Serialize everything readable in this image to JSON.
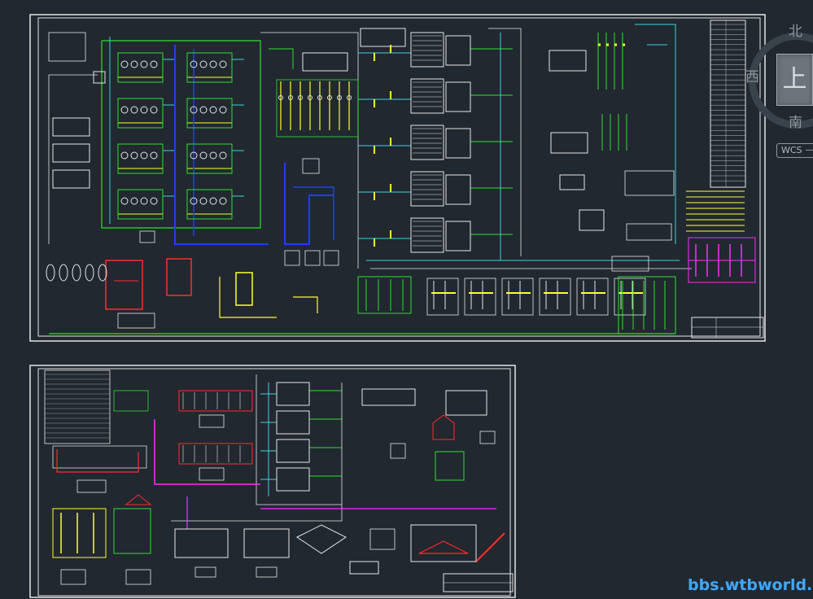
{
  "viewcube": {
    "north": "北",
    "west": "西",
    "south": "南",
    "face": "上",
    "wcs_label": "WCS"
  },
  "watermark": "bbs.wtbworld.com",
  "colors": {
    "background": "#212830",
    "frame": "#e6e6e6",
    "pipe_green": "#2ee02e",
    "pipe_cyan": "#3fd0e0",
    "pipe_blue": "#1f3cff",
    "pipe_red": "#ff2a2a",
    "pipe_yellow": "#ffff2a",
    "pipe_magenta": "#ff2aff",
    "watermark": "#40a8ff"
  }
}
